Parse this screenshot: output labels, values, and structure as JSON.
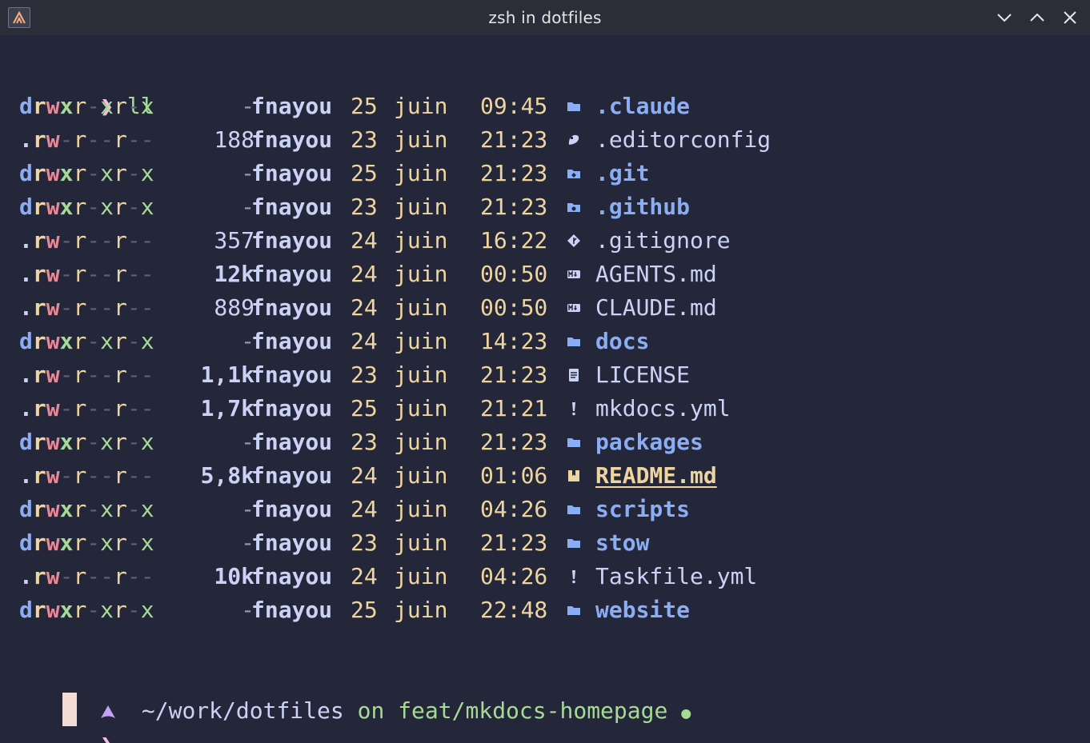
{
  "window": {
    "title": "zsh in dotfiles",
    "app_icon": "terminal-app-icon",
    "controls": {
      "minimize_icon": "chevron-down-icon",
      "maximize_icon": "chevron-up-icon",
      "close_icon": "close-icon"
    }
  },
  "colors": {
    "background": "#24273a",
    "titlebar": "#2b2d38",
    "blue": "#8aadf4",
    "yellow": "#eed49f",
    "red": "#ed8796",
    "green": "#a6da95",
    "pink": "#f5bde6",
    "text": "#cad3f5",
    "cursor": "#f4dbd6"
  },
  "command": {
    "prompt": "❯",
    "text": "ll"
  },
  "listing": [
    {
      "perm": "drwxr-xr-x",
      "size": "-",
      "owner": "fnayou",
      "day": "25",
      "month": "juin",
      "time": "09:45",
      "icon": "folder-icon",
      "name": ".claude",
      "kind": "dir"
    },
    {
      "perm": ".rw-r--r--",
      "size": "188",
      "owner": "fnayou",
      "day": "23",
      "month": "juin",
      "time": "21:23",
      "icon": "editorconfig-icon",
      "name": ".editorconfig",
      "kind": "file"
    },
    {
      "perm": "drwxr-xr-x",
      "size": "-",
      "owner": "fnayou",
      "day": "25",
      "month": "juin",
      "time": "21:23",
      "icon": "git-folder-icon",
      "name": ".git",
      "kind": "dir"
    },
    {
      "perm": "drwxr-xr-x",
      "size": "-",
      "owner": "fnayou",
      "day": "23",
      "month": "juin",
      "time": "21:23",
      "icon": "github-folder-icon",
      "name": ".github",
      "kind": "dir"
    },
    {
      "perm": ".rw-r--r--",
      "size": "357",
      "owner": "fnayou",
      "day": "24",
      "month": "juin",
      "time": "16:22",
      "icon": "git-icon",
      "name": ".gitignore",
      "kind": "file"
    },
    {
      "perm": ".rw-r--r--",
      "size": "12k",
      "owner": "fnayou",
      "day": "24",
      "month": "juin",
      "time": "00:50",
      "icon": "markdown-icon",
      "name": "AGENTS.md",
      "kind": "file"
    },
    {
      "perm": ".rw-r--r--",
      "size": "889",
      "owner": "fnayou",
      "day": "24",
      "month": "juin",
      "time": "00:50",
      "icon": "markdown-icon",
      "name": "CLAUDE.md",
      "kind": "file"
    },
    {
      "perm": "drwxr-xr-x",
      "size": "-",
      "owner": "fnayou",
      "day": "24",
      "month": "juin",
      "time": "14:23",
      "icon": "folder-icon",
      "name": "docs",
      "kind": "dir"
    },
    {
      "perm": ".rw-r--r--",
      "size": "1,1k",
      "owner": "fnayou",
      "day": "23",
      "month": "juin",
      "time": "21:23",
      "icon": "license-icon",
      "name": "LICENSE",
      "kind": "file"
    },
    {
      "perm": ".rw-r--r--",
      "size": "1,7k",
      "owner": "fnayou",
      "day": "25",
      "month": "juin",
      "time": "21:21",
      "icon": "yaml-icon",
      "name": "mkdocs.yml",
      "kind": "file"
    },
    {
      "perm": "drwxr-xr-x",
      "size": "-",
      "owner": "fnayou",
      "day": "23",
      "month": "juin",
      "time": "21:23",
      "icon": "folder-icon",
      "name": "packages",
      "kind": "dir"
    },
    {
      "perm": ".rw-r--r--",
      "size": "5,8k",
      "owner": "fnayou",
      "day": "24",
      "month": "juin",
      "time": "01:06",
      "icon": "readme-icon",
      "name": "README.md",
      "kind": "readme"
    },
    {
      "perm": "drwxr-xr-x",
      "size": "-",
      "owner": "fnayou",
      "day": "24",
      "month": "juin",
      "time": "04:26",
      "icon": "folder-icon",
      "name": "scripts",
      "kind": "dir"
    },
    {
      "perm": "drwxr-xr-x",
      "size": "-",
      "owner": "fnayou",
      "day": "23",
      "month": "juin",
      "time": "21:23",
      "icon": "folder-icon",
      "name": "stow",
      "kind": "dir"
    },
    {
      "perm": ".rw-r--r--",
      "size": "10k",
      "owner": "fnayou",
      "day": "24",
      "month": "juin",
      "time": "04:26",
      "icon": "yaml-icon",
      "name": "Taskfile.yml",
      "kind": "file"
    },
    {
      "perm": "drwxr-xr-x",
      "size": "-",
      "owner": "fnayou",
      "day": "25",
      "month": "juin",
      "time": "22:48",
      "icon": "folder-icon",
      "name": "website",
      "kind": "dir"
    }
  ],
  "status_line": {
    "os_icon": "arch-icon",
    "path": "~/work/dotfiles",
    "on": "on",
    "branch_icon": "git-branch-icon",
    "branch_symbol": "",
    "branch": "feat/mkdocs-homepage",
    "dirty": "●"
  },
  "input_prompt": {
    "symbol": "❯"
  }
}
